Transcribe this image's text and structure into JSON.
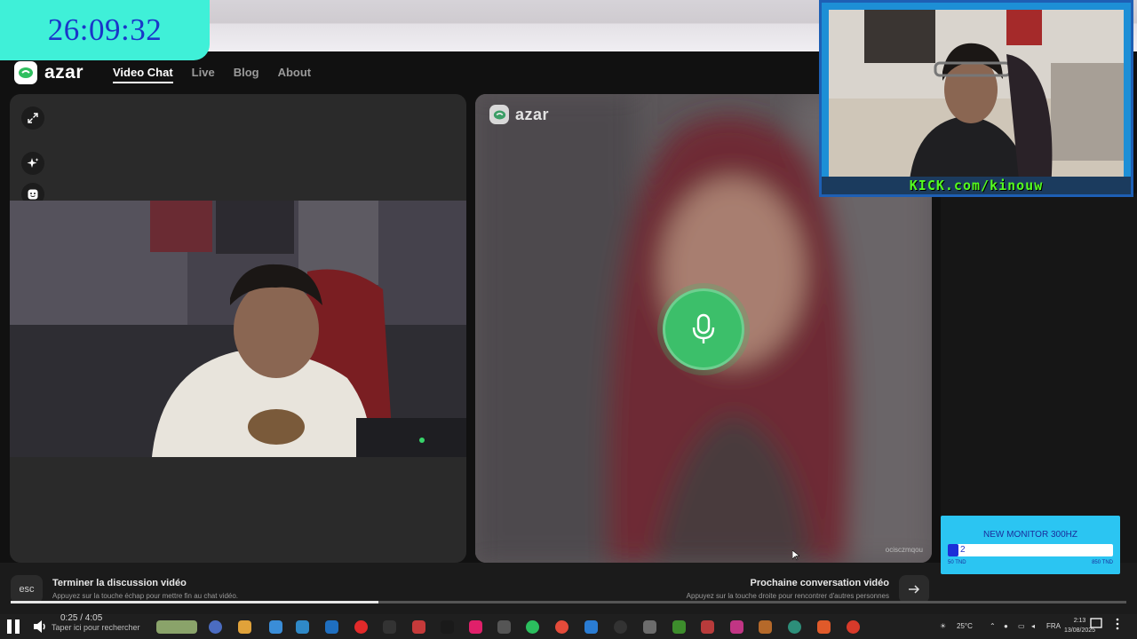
{
  "timer": "26:09:32",
  "brand": "azar",
  "nav": {
    "items": [
      "Video Chat",
      "Live",
      "Blog",
      "About"
    ]
  },
  "footer": {
    "esc_key": "esc",
    "end_title": "Terminer la discussion vidéo",
    "end_sub": "Appuyez sur la touche échap pour mettre fin au chat vidéo.",
    "next_title": "Prochaine conversation vidéo",
    "next_sub": "Appuyez sur la touche droite pour rencontrer d'autres personnes"
  },
  "partner_id": "ocisczmqou",
  "overlay": {
    "kick_url": "KICK.com/kinouw"
  },
  "goal": {
    "title": "NEW MONITOR 300HZ",
    "value": "2",
    "min": "50 TND",
    "max": "850 TND",
    "progress_fraction": 0.04
  },
  "player": {
    "time": "0:25 / 4:05",
    "progress_fraction": 0.33
  },
  "taskbar": {
    "search": "Taper ici pour rechercher",
    "weather": "25°C",
    "lang": "FRA",
    "time": "2:13",
    "date": "13/08/2025"
  },
  "colors": {
    "timer_bg": "#3ff0d8",
    "mic_green": "#3cbf6a",
    "kick_green": "#54fc1f",
    "goal_bg": "#2bc5f2"
  },
  "icons": [
    "expand-icon",
    "sparkle-icon",
    "sticker-icon",
    "microphone-icon",
    "arrow-right-icon"
  ]
}
